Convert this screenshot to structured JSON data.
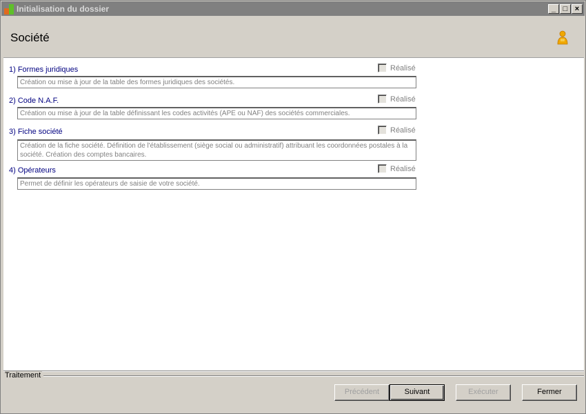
{
  "window": {
    "title": "Initialisation du dossier",
    "minimize": "_",
    "maximize": "□",
    "close": "×"
  },
  "header": {
    "title": "Société",
    "user_icon": "user-icon"
  },
  "steps": [
    {
      "label": "1) Formes juridiques",
      "done_label": "Réalisé",
      "checked": false,
      "description": "Création ou mise à jour de la table des formes juridiques des sociétés."
    },
    {
      "label": "2) Code N.A.F.",
      "done_label": "Réalisé",
      "checked": false,
      "description": "Création ou mise à jour de la table définissant les codes activités (APE ou NAF) des sociétés commerciales."
    },
    {
      "label": "3) Fiche société",
      "done_label": "Réalisé",
      "checked": false,
      "description": "Création de la fiche société. Définition de l'établissement (siège social ou administratif) attribuant les coordonnées postales à la société. Création des comptes bancaires."
    },
    {
      "label": "4) Opérateurs",
      "done_label": "Réalisé",
      "checked": false,
      "description": "Permet de définir les opérateurs de saisie de votre société."
    }
  ],
  "footer": {
    "group_label": "Traitement",
    "buttons": {
      "previous": "Précédent",
      "next": "Suivant",
      "execute": "Exécuter",
      "close": "Fermer"
    }
  },
  "colors": {
    "titlebar": "#808080",
    "step_label": "#000080",
    "user_icon": "#f0a800"
  }
}
